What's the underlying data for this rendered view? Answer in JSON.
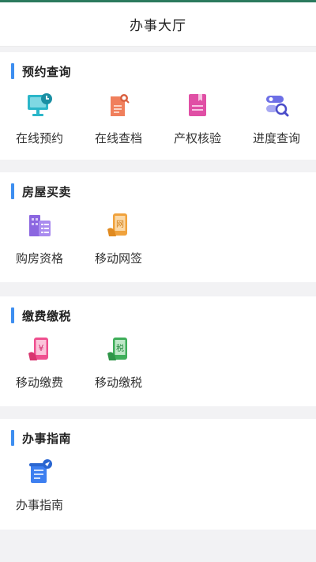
{
  "header": {
    "title": "办事大厅"
  },
  "sections": [
    {
      "title": "预约查询",
      "items": [
        {
          "label": "在线预约",
          "icon": "monitor-clock-icon",
          "color": "#2bb6c9"
        },
        {
          "label": "在线查档",
          "icon": "document-search-icon",
          "color": "#f07f5c"
        },
        {
          "label": "产权核验",
          "icon": "bookmark-document-icon",
          "color": "#e04fa5"
        },
        {
          "label": "进度查询",
          "icon": "progress-search-icon",
          "color": "#6d6fe6"
        }
      ]
    },
    {
      "title": "房屋买卖",
      "items": [
        {
          "label": "购房资格",
          "icon": "building-checklist-icon",
          "color": "#8b66e0"
        },
        {
          "label": "移动网签",
          "icon": "phone-sign-icon",
          "color": "#f0a23c"
        }
      ]
    },
    {
      "title": "缴费缴税",
      "items": [
        {
          "label": "移动缴费",
          "icon": "phone-yen-icon",
          "color": "#ef4f8f"
        },
        {
          "label": "移动缴税",
          "icon": "phone-tax-icon",
          "color": "#3fae5a"
        }
      ]
    },
    {
      "title": "办事指南",
      "items": [
        {
          "label": "办事指南",
          "icon": "guide-book-icon",
          "color": "#3d7ff0"
        }
      ]
    }
  ],
  "icon_glyphs": {
    "tax": "税",
    "net": "网",
    "yen": "¥"
  },
  "colors": {
    "accent_bar": "#3d8ef0",
    "page_bg": "#f2f2f4",
    "top_line": "#2b7a5e"
  }
}
